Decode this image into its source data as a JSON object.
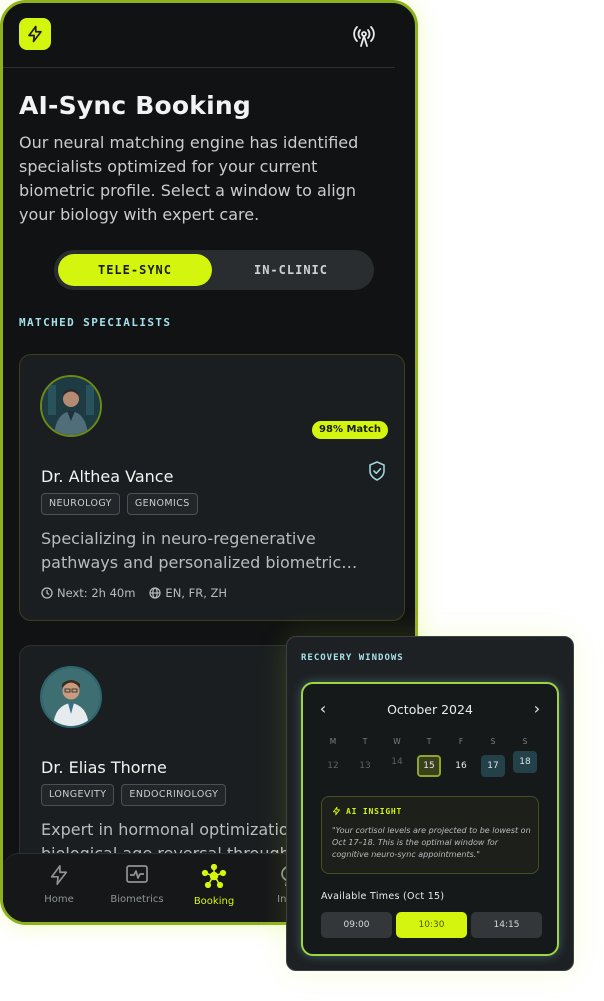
{
  "header": {
    "logo_icon": "bolt-icon",
    "status_icon": "signal-icon"
  },
  "title": "AI-Sync Booking",
  "intro": "Our neural matching engine has identified specialists optimized for your current biometric profile. Select a window to align your biology with expert care.",
  "mode_toggle": {
    "options": [
      "TELE-SYNC",
      "IN-CLINIC"
    ],
    "selected": "TELE-SYNC"
  },
  "section_label": "MATCHED SPECIALISTS",
  "specialists": [
    {
      "name": "Dr. Althea Vance",
      "match": "98% Match",
      "tags": [
        "NEUROLOGY",
        "GENOMICS"
      ],
      "description": "Specializing in neuro-regenerative pathways and personalized biometric…",
      "next": "Next: 2h 40m",
      "languages": "EN, FR, ZH"
    },
    {
      "name": "Dr. Elias Thorne",
      "tags": [
        "LONGEVITY",
        "ENDOCRINOLOGY"
      ],
      "description": "Expert in hormonal optimization and biological age reversal through A…"
    }
  ],
  "nav": [
    {
      "label": "Home",
      "icon": "bolt-icon"
    },
    {
      "label": "Biometrics",
      "icon": "heart-monitor-icon"
    },
    {
      "label": "Booking",
      "icon": "network-icon",
      "active": true
    },
    {
      "label": "Intelli",
      "icon": "chat-icon"
    }
  ],
  "recovery": {
    "title": "RECOVERY WINDOWS",
    "month": "October 2024",
    "weekdays": [
      "M",
      "T",
      "W",
      "T",
      "F",
      "S",
      "S"
    ],
    "days": [
      "12",
      "13",
      "14",
      "15",
      "16",
      "17",
      "18"
    ],
    "selected_day": "15",
    "optimal_days": [
      "17",
      "18"
    ],
    "insight_title": "AI INSIGHT",
    "insight_text": "\"Your cortisol levels are projected to be lowest on Oct 17–18. This is the optimal window for cognitive neuro-sync appointments.\"",
    "available_label": "Available Times (Oct 15)",
    "times": [
      "09:00",
      "10:30",
      "14:15"
    ],
    "selected_time": "10:30"
  },
  "colors": {
    "accent": "#d4f50e",
    "cyan": "#a4e0ea",
    "background": "#101213"
  }
}
